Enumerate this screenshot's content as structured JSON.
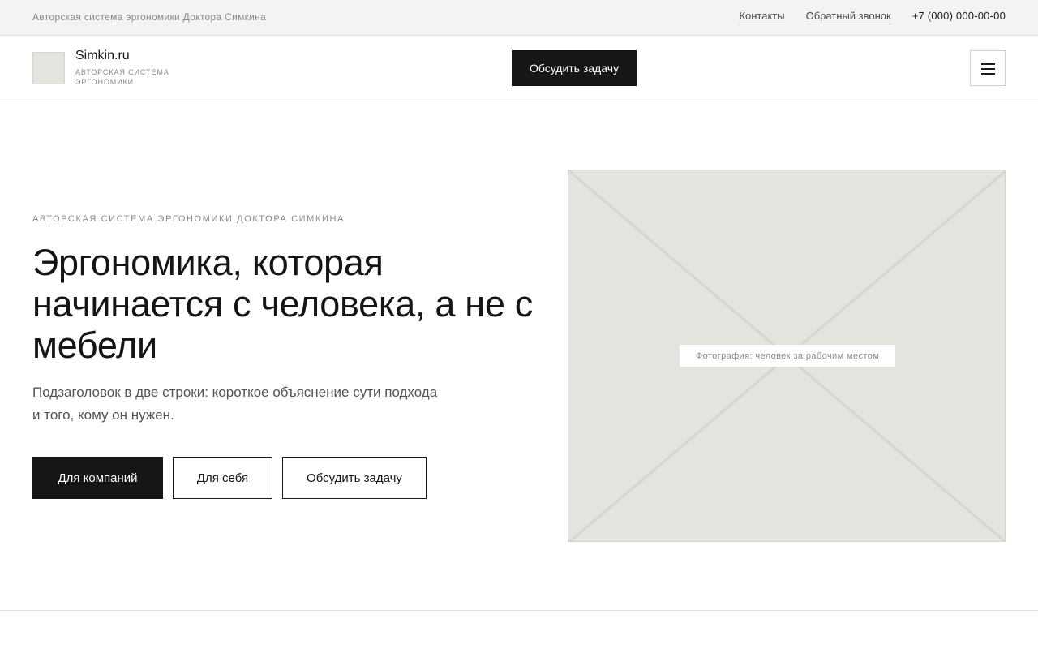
{
  "topbar": {
    "tagline": "Авторская система эргономики Доктора Симкина",
    "links": [
      "Контакты",
      "Обратный звонок"
    ],
    "phone": "+7 (000) 000-00-00"
  },
  "header": {
    "brand_name": "Simkin.ru",
    "brand_sub": "АВТОРСКАЯ СИСТЕМА ЭРГОНОМИКИ",
    "cta_label": "Обсудить задачу",
    "menu_icon": "hamburger-icon"
  },
  "hero": {
    "eyebrow": "АВТОРСКАЯ СИСТЕМА ЭРГОНОМИКИ ДОКТОРА СИМКИНА",
    "title": "Эргономика, которая начинается с человека, а не с мебели",
    "subtitle_line1": "Подзаголовок в две строки: короткое объяснение сути подхода",
    "subtitle_line2": "и того, кому он нужен.",
    "buttons": [
      "Для компаний",
      "Для себя",
      "Обсудить задачу"
    ],
    "photo_caption": "Фотография: человек за рабочим местом"
  },
  "colors": {
    "accent_dark": "#161616",
    "placeholder_bg": "#e4e4df",
    "topbar_bg": "#f3f3f1"
  }
}
